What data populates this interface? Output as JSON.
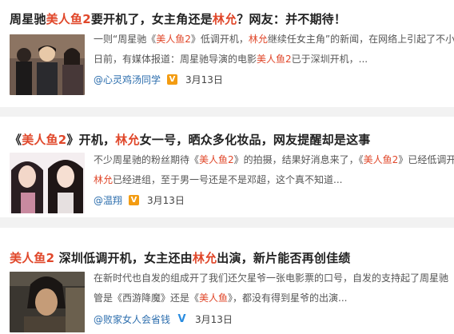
{
  "articles": [
    {
      "title_parts": [
        {
          "text": "周星驰",
          "hl": false
        },
        {
          "text": "美人鱼2",
          "hl": true
        },
        {
          "text": "要开机了，女主角还是",
          "hl": false
        },
        {
          "text": "林允",
          "hl": true
        },
        {
          "text": "？网友：并不期待！",
          "hl": false
        }
      ],
      "summary_lines": [
        [
          {
            "text": "一则“周星驰《",
            "hl": false
          },
          {
            "text": "美人鱼2",
            "hl": true
          },
          {
            "text": "》低调开机，",
            "hl": false
          },
          {
            "text": "林允",
            "hl": true
          },
          {
            "text": "继续任女主角”的新闻，在网络上引起了不小的",
            "hl": false
          }
        ],
        [
          {
            "text": "日前，有媒体报道：周星驰导演的电影",
            "hl": false
          },
          {
            "text": "美人鱼2",
            "hl": true
          },
          {
            "text": "已于深圳开机，...",
            "hl": false
          }
        ]
      ],
      "author": "@心灵鸡汤同学",
      "verified_badge": "orange-v-badge",
      "date": "3月13日"
    },
    {
      "title_parts": [
        {
          "text": "《",
          "hl": false
        },
        {
          "text": "美人鱼2",
          "hl": true
        },
        {
          "text": "》开机，",
          "hl": false
        },
        {
          "text": "林允",
          "hl": true
        },
        {
          "text": "女一号，晒众多化妆品，网友提醒却是这事",
          "hl": false
        }
      ],
      "summary_lines": [
        [
          {
            "text": "不少周星驰的粉丝期待《",
            "hl": false
          },
          {
            "text": "美人鱼2",
            "hl": true
          },
          {
            "text": "》的拍摄，结果好消息来了，《",
            "hl": false
          },
          {
            "text": "美人鱼2",
            "hl": true
          },
          {
            "text": "》已经低调开",
            "hl": false
          }
        ],
        [
          {
            "text": "林允",
            "hl": true
          },
          {
            "text": "已经进组，至于男一号还是不是邓超，这个真不知道...",
            "hl": false
          }
        ]
      ],
      "author": "@温翔",
      "verified_badge": "orange-v-badge",
      "date": "3月13日"
    },
    {
      "title_parts": [
        {
          "text": "美人鱼2",
          "hl": true
        },
        {
          "text": " 深圳低调开机，女主还由",
          "hl": false
        },
        {
          "text": "林允",
          "hl": true
        },
        {
          "text": "出演，新片能否再创佳绩",
          "hl": false
        }
      ],
      "summary_lines": [
        [
          {
            "text": "在新时代也自发的组成开了我们还欠星爷一张电影票的口号，自发的支持起了周星驰",
            "hl": false
          }
        ],
        [
          {
            "text": "管是《西游降魔》还是《",
            "hl": false
          },
          {
            "text": "美人鱼",
            "hl": true
          },
          {
            "text": "》，都没有得到星爷的出演...",
            "hl": false
          }
        ]
      ],
      "author": "@败家女人会省钱",
      "verified_badge": "blue-v-badge",
      "date": "3月13日"
    }
  ],
  "colors": {
    "highlight": "#e0472a",
    "author_link": "#2b6dad",
    "badge_orange": "#f39c12",
    "badge_blue": "#2b8de0",
    "page_background": "#f2f2f2"
  }
}
